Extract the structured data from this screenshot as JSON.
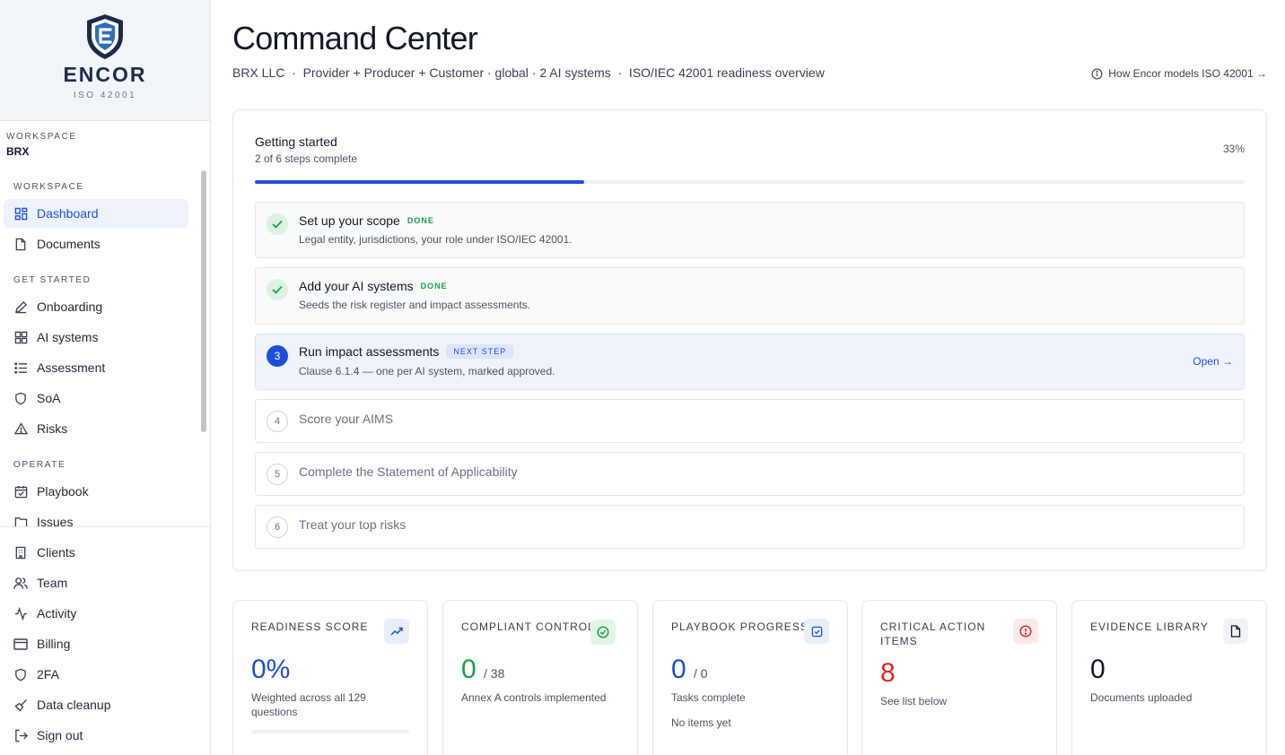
{
  "brand": {
    "name": "ENCOR",
    "sub": "ISO 42001"
  },
  "workspace": {
    "caption": "WORKSPACE",
    "name": "BRX"
  },
  "nav": {
    "sections": {
      "workspace": "WORKSPACE",
      "get_started": "GET STARTED",
      "operate": "OPERATE"
    },
    "items": {
      "dashboard": "Dashboard",
      "documents": "Documents",
      "onboarding": "Onboarding",
      "ai_systems": "AI systems",
      "assessment": "Assessment",
      "soa": "SoA",
      "risks": "Risks",
      "playbook": "Playbook",
      "issues": "Issues"
    },
    "bottom": {
      "clients": "Clients",
      "team": "Team",
      "activity": "Activity",
      "billing": "Billing",
      "twofa": "2FA",
      "cleanup": "Data cleanup",
      "signout": "Sign out"
    }
  },
  "header": {
    "title": "Command Center",
    "subtitle": "BRX LLC  ·  Provider + Producer + Customer · global · 2 AI systems  ·  ISO/IEC 42001 readiness overview",
    "help_link": "How Encor models ISO 42001 →"
  },
  "getting_started": {
    "title": "Getting started",
    "subtitle": "2 of 6 steps complete",
    "percent_label": "33%",
    "progress": 0.333,
    "steps": [
      {
        "num": "1",
        "title": "Set up your scope",
        "tag": "DONE",
        "desc": "Legal entity, jurisdictions, your role under ISO/IEC 42001."
      },
      {
        "num": "2",
        "title": "Add your AI systems",
        "tag": "DONE",
        "desc": "Seeds the risk register and impact assessments."
      },
      {
        "num": "3",
        "title": "Run impact assessments",
        "tag": "NEXT STEP",
        "desc": "Clause 6.1.4 — one per AI system, marked approved.",
        "action": "Open →"
      },
      {
        "num": "4",
        "title": "Score your AIMS"
      },
      {
        "num": "5",
        "title": "Complete the Statement of Applicability"
      },
      {
        "num": "6",
        "title": "Treat your top risks"
      }
    ]
  },
  "stats": {
    "readiness": {
      "label": "READINESS SCORE",
      "value": "0%",
      "desc": "Weighted across all 129 questions",
      "icon": "trending-up-icon",
      "color": "#1d4ed8"
    },
    "controls": {
      "label": "COMPLIANT CONTROLS",
      "value": "0",
      "total": "/ 38",
      "desc": "Annex A controls implemented",
      "icon": "check-circle-icon",
      "color": "#16a34a"
    },
    "playbook": {
      "label": "PLAYBOOK PROGRESS",
      "value": "0",
      "total": "/ 0",
      "desc": "Tasks complete",
      "note": "No items yet",
      "icon": "checkbox-icon",
      "color": "#1d4ed8"
    },
    "critical": {
      "label": "CRITICAL ACTION ITEMS",
      "value": "8",
      "desc": "See list below",
      "icon": "alert-circle-icon",
      "color": "#dc2626"
    },
    "evidence": {
      "label": "EVIDENCE LIBRARY",
      "value": "0",
      "desc": "Documents uploaded",
      "icon": "document-icon",
      "color": "#111827"
    }
  }
}
